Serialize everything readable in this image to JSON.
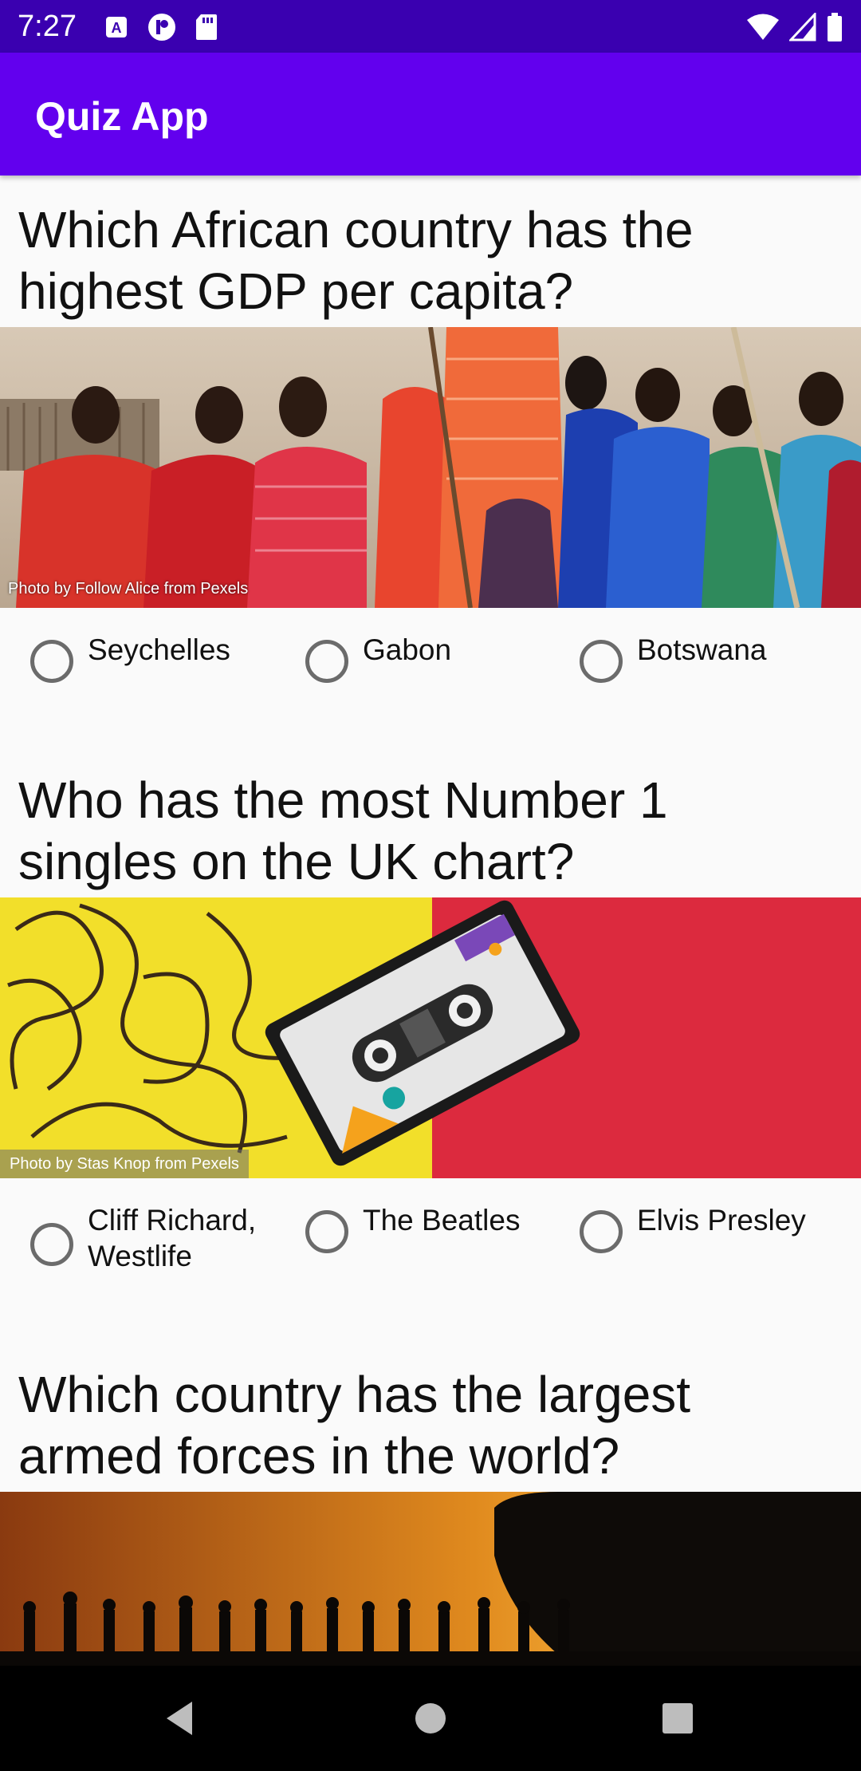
{
  "status_bar": {
    "time": "7:27",
    "left_icons": [
      "a-icon",
      "circle-r-icon",
      "sd-card-icon"
    ],
    "right_icons": [
      "wifi-icon",
      "signal-icon",
      "battery-icon"
    ]
  },
  "app_bar": {
    "title": "Quiz App"
  },
  "questions": [
    {
      "text": "Which African country has the highest GDP per capita?",
      "image_credit": "Photo by Follow Alice from Pexels",
      "options": [
        "Seychelles",
        "Gabon",
        "Botswana"
      ]
    },
    {
      "text": "Who has the most Number 1 singles on the UK chart?",
      "image_credit": "Photo by Stas Knop from Pexels",
      "options": [
        "Cliff Richard, Westlife",
        "The Beatles",
        "Elvis Presley"
      ]
    },
    {
      "text": "Which country has the largest armed forces in the world?",
      "image_credit": "",
      "options": []
    }
  ],
  "nav_bar": {
    "buttons": [
      "back-icon",
      "home-icon",
      "recents-icon"
    ]
  },
  "colors": {
    "status_bar": "#3a00b0",
    "app_bar": "#6200ee",
    "nav_bar": "#000000"
  }
}
